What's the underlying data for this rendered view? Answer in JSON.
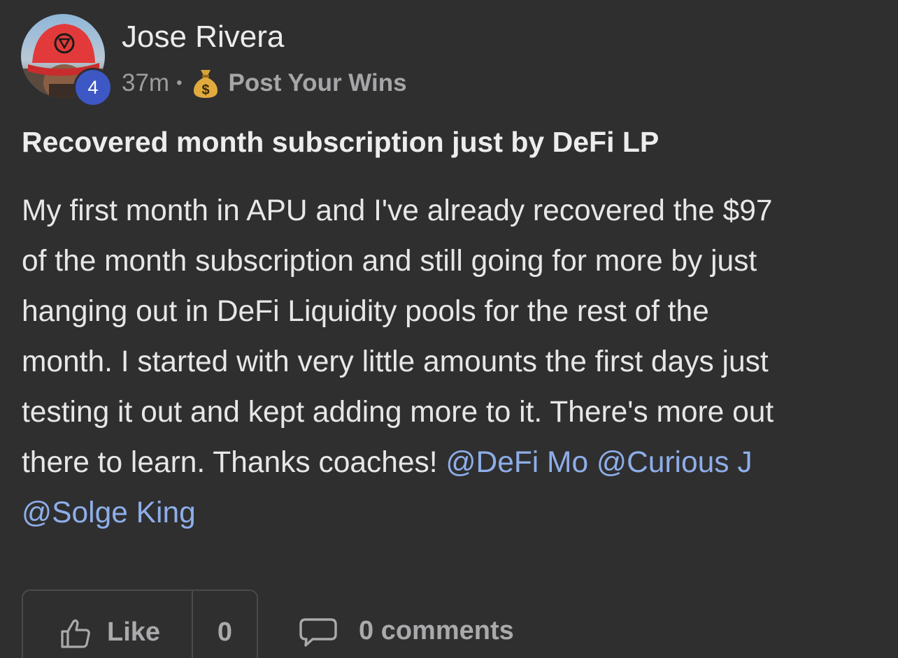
{
  "author": {
    "name": "Jose Rivera",
    "level": "4"
  },
  "meta": {
    "time": "37m",
    "separator": "•",
    "category_icon": "money-bag-icon",
    "category": "Post Your Wins"
  },
  "post": {
    "title": "Recovered month subscription just by DeFi LP",
    "body_lines": [
      "My first month in APU and I've already recovered the $97",
      "of the month subscription and still going for more by just",
      "hanging out in DeFi Liquidity pools for the rest of the",
      "month. I started with very little amounts the first days just",
      "testing it out and kept adding more to it. There's more out",
      "there to learn. Thanks coaches! "
    ],
    "mentions": [
      "@DeFi Mo",
      "@Curious J",
      "@Solge King"
    ]
  },
  "actions": {
    "like_label": "Like",
    "like_count": "0",
    "comments_label": "0 comments"
  },
  "colors": {
    "background": "#2f2f30",
    "mention": "#8eaee9",
    "level_badge": "#3d57c4"
  }
}
